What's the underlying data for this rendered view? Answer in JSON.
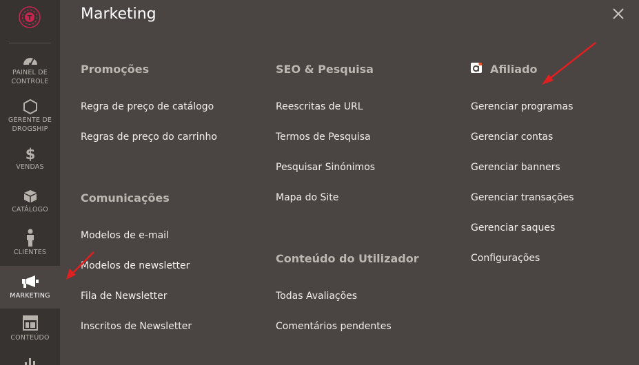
{
  "sidebar": {
    "logo_icon": "brand-logo-icon",
    "items": [
      {
        "label_1": "PAINEL DE",
        "label_2": "CONTROLE",
        "icon": "dashboard-gauge-icon"
      },
      {
        "label_1": "GERENTE DE",
        "label_2": "DROGSHIP",
        "icon": "hexagon-icon"
      },
      {
        "label": "VENDAS",
        "icon": "dollar-icon"
      },
      {
        "label": "CATÁLOGO",
        "icon": "cube-icon"
      },
      {
        "label": "CLIENTES",
        "icon": "person-icon"
      },
      {
        "label": "MARKETING",
        "icon": "megaphone-icon"
      },
      {
        "label": "CONTEÚDO",
        "icon": "layout-icon"
      }
    ]
  },
  "panel": {
    "title": "Marketing",
    "close_icon": "close-icon",
    "columns": {
      "promocoes": {
        "title": "Promoções",
        "links": [
          "Regra de preço de catálogo",
          "Regras de preço do carrinho"
        ]
      },
      "comunicacoes": {
        "title": "Comunicações",
        "links": [
          "Modelos de e-mail",
          "Modelos de newsletter",
          "Fila de Newsletter",
          "Inscritos de Newsletter"
        ]
      },
      "seo": {
        "title": "SEO & Pesquisa",
        "links": [
          "Reescritas de URL",
          "Termos de Pesquisa",
          "Pesquisar Sinónimos",
          "Mapa do Site"
        ]
      },
      "conteudo_utilizador": {
        "title": "Conteúdo do Utilizador",
        "links": [
          "Todas Avaliações",
          "Comentários pendentes"
        ]
      },
      "afiliado": {
        "title": "Afiliado",
        "icon": "affiliate-logo-icon",
        "links": [
          "Gerenciar programas",
          "Gerenciar contas",
          "Gerenciar banners",
          "Gerenciar transações",
          "Gerenciar saques",
          "Configurações"
        ]
      }
    }
  },
  "colors": {
    "sidebar_bg": "#373330",
    "panel_bg": "#4a4542",
    "annotation_arrow": "#e02020",
    "logo_accent": "#e0245e"
  }
}
